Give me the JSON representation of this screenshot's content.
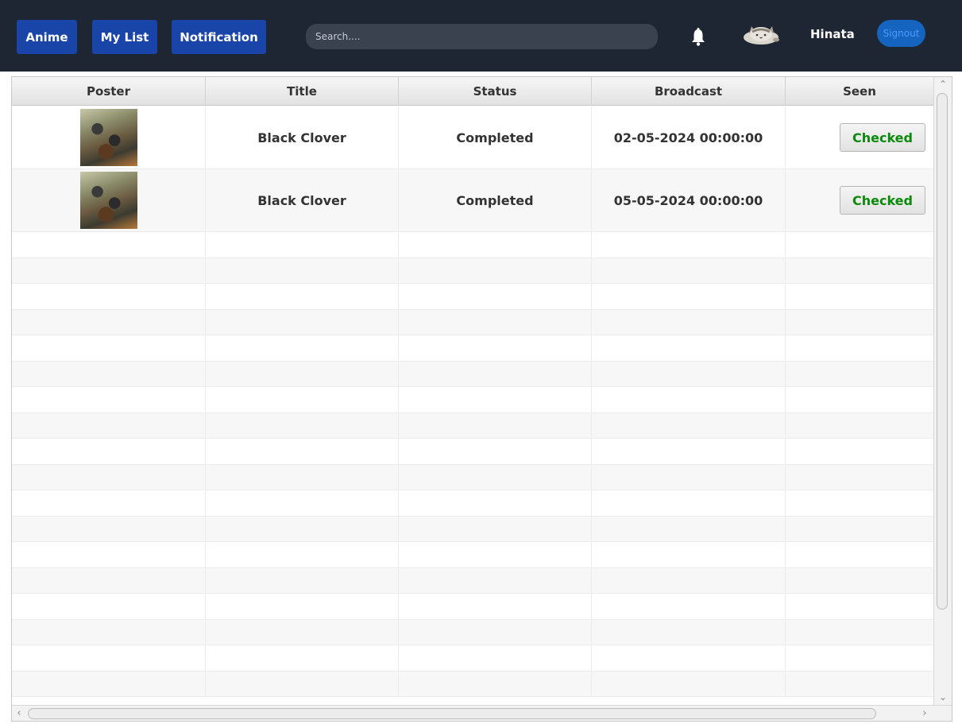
{
  "nav": {
    "anime_label": "Anime",
    "mylist_label": "My List",
    "notification_label": "Notification"
  },
  "search": {
    "placeholder": "Search...."
  },
  "user": {
    "name": "Hinata",
    "signout_label": "Signout",
    "avatar_icon": "cat-avatar-icon",
    "bell_icon": "bell-icon"
  },
  "table": {
    "headers": [
      "Poster",
      "Title",
      "Status",
      "Broadcast",
      "Seen"
    ],
    "rows": [
      {
        "poster": "Black Clover poster",
        "title": "Black Clover",
        "status": "Completed",
        "broadcast": "02-05-2024 00:00:00",
        "seen": "Checked"
      },
      {
        "poster": "Black Clover poster",
        "title": "Black Clover",
        "status": "Completed",
        "broadcast": "05-05-2024 00:00:00",
        "seen": "Checked"
      }
    ]
  },
  "colors": {
    "topbar": "#1f2633",
    "nav_button": "#1a45a8",
    "signout_button": "#1565c0",
    "checked_text": "#0a8a0a"
  }
}
